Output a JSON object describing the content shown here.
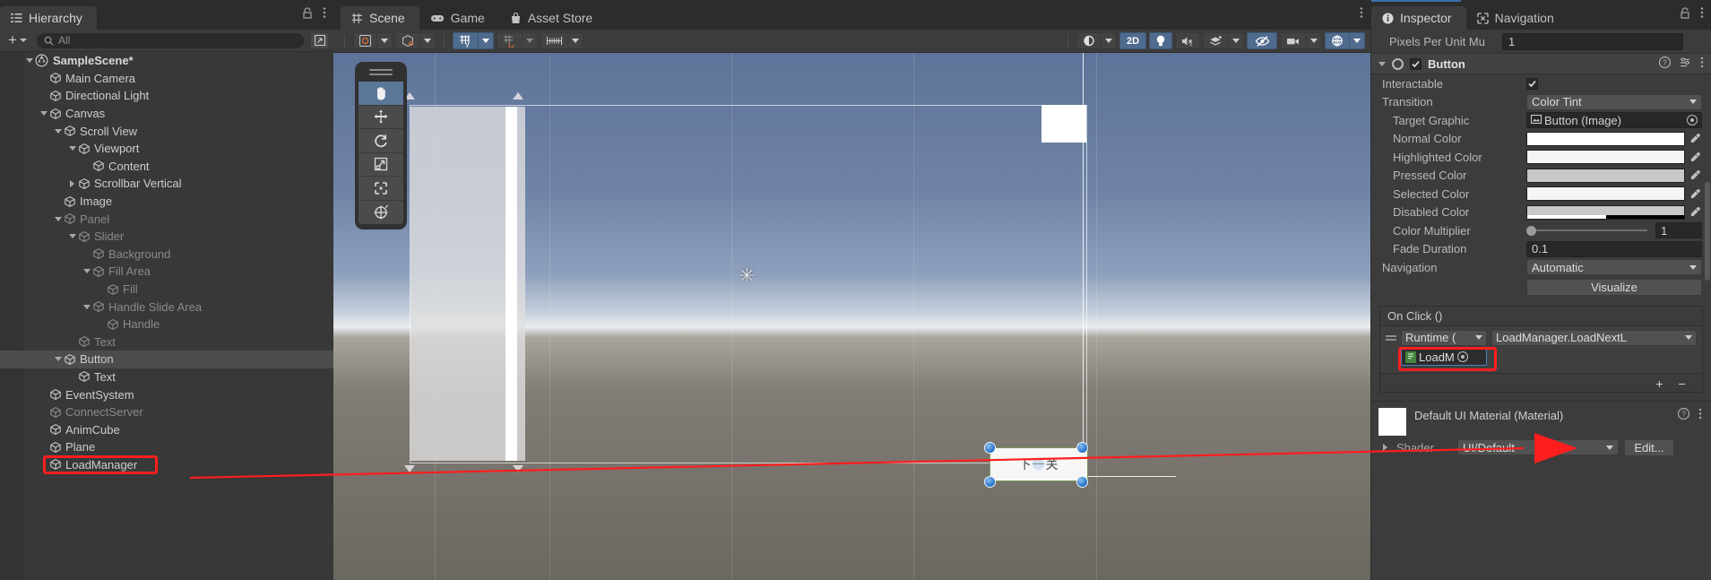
{
  "hierarchy": {
    "tab_label": "Hierarchy",
    "tab_icon": "hierarchy-icon",
    "lock_icon": "lock-icon",
    "kebab_icon": "kebab-menu-icon",
    "add_label": "+",
    "search_placeholder": "All",
    "search_value": "",
    "search_icon": "search-icon",
    "items": [
      {
        "label": "SampleScene*",
        "depth": 0,
        "twist": "down",
        "icon": "unity-scene-icon",
        "selected": false,
        "dim": false,
        "scene": true
      },
      {
        "label": "Main Camera",
        "depth": 1,
        "twist": "none",
        "icon": "gameobject-cube-icon",
        "selected": false,
        "dim": false
      },
      {
        "label": "Directional Light",
        "depth": 1,
        "twist": "none",
        "icon": "gameobject-cube-icon",
        "selected": false,
        "dim": false
      },
      {
        "label": "Canvas",
        "depth": 1,
        "twist": "down",
        "icon": "gameobject-cube-icon",
        "selected": false,
        "dim": false
      },
      {
        "label": "Scroll View",
        "depth": 2,
        "twist": "down",
        "icon": "gameobject-cube-icon",
        "selected": false,
        "dim": false
      },
      {
        "label": "Viewport",
        "depth": 3,
        "twist": "down",
        "icon": "gameobject-cube-icon",
        "selected": false,
        "dim": false
      },
      {
        "label": "Content",
        "depth": 4,
        "twist": "none",
        "icon": "gameobject-cube-icon",
        "selected": false,
        "dim": false
      },
      {
        "label": "Scrollbar Vertical",
        "depth": 3,
        "twist": "right",
        "icon": "gameobject-cube-icon",
        "selected": false,
        "dim": false
      },
      {
        "label": "Image",
        "depth": 2,
        "twist": "none",
        "icon": "gameobject-cube-icon",
        "selected": false,
        "dim": false
      },
      {
        "label": "Panel",
        "depth": 2,
        "twist": "down",
        "icon": "gameobject-cube-icon",
        "selected": false,
        "dim": true
      },
      {
        "label": "Slider",
        "depth": 3,
        "twist": "down",
        "icon": "gameobject-cube-icon",
        "selected": false,
        "dim": true
      },
      {
        "label": "Background",
        "depth": 4,
        "twist": "none",
        "icon": "gameobject-cube-icon",
        "selected": false,
        "dim": true
      },
      {
        "label": "Fill Area",
        "depth": 4,
        "twist": "down",
        "icon": "gameobject-cube-icon",
        "selected": false,
        "dim": true
      },
      {
        "label": "Fill",
        "depth": 5,
        "twist": "none",
        "icon": "gameobject-cube-icon",
        "selected": false,
        "dim": true
      },
      {
        "label": "Handle Slide Area",
        "depth": 4,
        "twist": "down",
        "icon": "gameobject-cube-icon",
        "selected": false,
        "dim": true
      },
      {
        "label": "Handle",
        "depth": 5,
        "twist": "none",
        "icon": "gameobject-cube-icon",
        "selected": false,
        "dim": true
      },
      {
        "label": "Text",
        "depth": 3,
        "twist": "none",
        "icon": "gameobject-cube-icon",
        "selected": false,
        "dim": true
      },
      {
        "label": "Button",
        "depth": 2,
        "twist": "down",
        "icon": "gameobject-cube-icon",
        "selected": true,
        "dim": false
      },
      {
        "label": "Text",
        "depth": 3,
        "twist": "none",
        "icon": "gameobject-cube-icon",
        "selected": false,
        "dim": false
      },
      {
        "label": "EventSystem",
        "depth": 1,
        "twist": "none",
        "icon": "gameobject-cube-icon",
        "selected": false,
        "dim": false
      },
      {
        "label": "ConnectServer",
        "depth": 1,
        "twist": "none",
        "icon": "gameobject-cube-icon",
        "selected": false,
        "dim": true
      },
      {
        "label": "AnimCube",
        "depth": 1,
        "twist": "none",
        "icon": "gameobject-cube-icon",
        "selected": false,
        "dim": false
      },
      {
        "label": "Plane",
        "depth": 1,
        "twist": "none",
        "icon": "gameobject-cube-icon",
        "selected": false,
        "dim": false
      },
      {
        "label": "LoadManager",
        "depth": 1,
        "twist": "none",
        "icon": "gameobject-cube-icon",
        "selected": false,
        "dim": false,
        "highlight": true
      }
    ]
  },
  "scene_panel": {
    "tabs": [
      {
        "label": "Scene",
        "icon": "scene-grid-icon",
        "active": true
      },
      {
        "label": "Game",
        "icon": "gamepad-icon",
        "active": false
      },
      {
        "label": "Asset Store",
        "icon": "store-bag-icon",
        "active": false
      }
    ],
    "kebab_icon": "kebab-menu-icon",
    "toolbar_left": [
      {
        "name": "pivot-mode-button",
        "label": "Center",
        "icon": "pivot-center-icon",
        "active": false,
        "has_dropdown": true
      },
      {
        "name": "handle-rotation-button",
        "label": "Global",
        "icon": "global-handle-icon",
        "active": false,
        "has_dropdown": true
      },
      {
        "name": "grid-snapping-button",
        "label": "Grid Y",
        "icon": "grid-axis-y-icon",
        "active": true,
        "has_dropdown": true
      },
      {
        "name": "grid-visibility-button",
        "label": "Grid Snap",
        "icon": "grid-snap-icon",
        "active": false,
        "has_dropdown": true,
        "disabled": true
      },
      {
        "name": "snap-increment-button",
        "label": "Snap Increment",
        "icon": "ruler-icon",
        "active": false,
        "has_dropdown": true
      }
    ],
    "toolbar_right": [
      {
        "name": "scene-shading-mode-button",
        "label": "Shaded",
        "icon": "shading-sphere-icon",
        "active": false,
        "has_dropdown": true
      },
      {
        "name": "toggle-2d-button",
        "label": "2D",
        "icon": "",
        "active": true,
        "has_dropdown": false
      },
      {
        "name": "scene-lighting-button",
        "label": "Lighting",
        "icon": "lightbulb-icon",
        "active": true,
        "has_dropdown": false
      },
      {
        "name": "scene-audio-button",
        "label": "Audio",
        "icon": "speaker-muted-icon",
        "active": false,
        "has_dropdown": false
      },
      {
        "name": "scene-fx-button",
        "label": "Effects",
        "icon": "effects-layers-icon",
        "active": false,
        "has_dropdown": true
      },
      {
        "name": "scene-visibility-button",
        "label": "Scene Visibility",
        "icon": "eye-crossed-icon",
        "active": true,
        "has_dropdown": false
      },
      {
        "name": "scene-camera-button",
        "label": "Camera",
        "icon": "camera-icon",
        "active": false,
        "has_dropdown": true
      },
      {
        "name": "gizmos-button",
        "label": "Gizmos",
        "icon": "gizmo-globe-icon",
        "active": true,
        "has_dropdown": true
      }
    ],
    "tool_palette": [
      {
        "name": "hand-tool",
        "icon": "hand-icon",
        "active": true
      },
      {
        "name": "move-tool",
        "icon": "move-arrows-icon",
        "active": false
      },
      {
        "name": "rotate-tool",
        "icon": "rotate-icon",
        "active": false
      },
      {
        "name": "scale-tool",
        "icon": "scale-icon",
        "active": false
      },
      {
        "name": "rect-tool",
        "icon": "rect-transform-icon",
        "active": false
      },
      {
        "name": "transform-tool",
        "icon": "transform-combined-icon",
        "active": false
      }
    ],
    "selected_object_text": "下一关"
  },
  "inspector": {
    "tabs": [
      {
        "label": "Inspector",
        "icon": "info-icon",
        "active": true
      },
      {
        "label": "Navigation",
        "icon": "navigation-icon",
        "active": false
      }
    ],
    "lock_icon": "lock-icon",
    "kebab_icon": "kebab-menu-icon",
    "ppu_label": "Pixels Per Unit Mu",
    "ppu_value": "1",
    "component": {
      "title": "Button",
      "enabled": true,
      "help_icon": "help-icon",
      "preset_icon": "preset-icon",
      "kebab_icon": "kebab-menu-icon",
      "toggle_icon": "component-toggle-icon"
    },
    "properties": [
      {
        "name": "interactable",
        "label": "Interactable",
        "type": "checkbox",
        "value": true,
        "indent": false
      },
      {
        "name": "transition",
        "label": "Transition",
        "type": "dropdown",
        "value": "Color Tint",
        "indent": false
      },
      {
        "name": "target-graphic",
        "label": "Target Graphic",
        "type": "object",
        "value": "Button (Image)",
        "icon": "image-component-icon",
        "indent": true
      },
      {
        "name": "normal-color",
        "label": "Normal Color",
        "type": "color",
        "value": "#FFFFFF",
        "indent": true
      },
      {
        "name": "highlighted-color",
        "label": "Highlighted Color",
        "type": "color",
        "value": "#F5F5F5",
        "indent": true
      },
      {
        "name": "pressed-color",
        "label": "Pressed Color",
        "type": "color",
        "value": "#C8C8C8",
        "indent": true
      },
      {
        "name": "selected-color",
        "label": "Selected Color",
        "type": "color",
        "value": "#F5F5F5",
        "indent": true
      },
      {
        "name": "disabled-color",
        "label": "Disabled Color",
        "type": "color-alpha",
        "value": "#C8C8C8",
        "alpha": 0.5,
        "indent": true
      },
      {
        "name": "color-multiplier",
        "label": "Color Multiplier",
        "type": "slider",
        "value": "1",
        "indent": true
      },
      {
        "name": "fade-duration",
        "label": "Fade Duration",
        "type": "number",
        "value": "0.1",
        "indent": true
      },
      {
        "name": "navigation",
        "label": "Navigation",
        "type": "dropdown",
        "value": "Automatic",
        "indent": false
      }
    ],
    "visualize_button": "Visualize",
    "on_click": {
      "title": "On Click ()",
      "runtime_label": "Runtime (",
      "function_label": "LoadManager.LoadNextL",
      "object_value": "LoadM",
      "object_icon": "script-asset-icon",
      "add_label": "+",
      "remove_label": "−",
      "highlight_color": "#ff1e1e"
    },
    "material": {
      "title": "Default UI Material (Material)",
      "shader_label": "Shader",
      "shader_value": "UI/Default",
      "edit_label": "Edit...",
      "help_icon": "help-icon",
      "kebab_icon": "kebab-menu-icon"
    }
  },
  "annotation": {
    "arrow_color": "#ff1e1e",
    "description": "red arrow from LoadManager in Hierarchy to LoadM object field in On Click"
  }
}
